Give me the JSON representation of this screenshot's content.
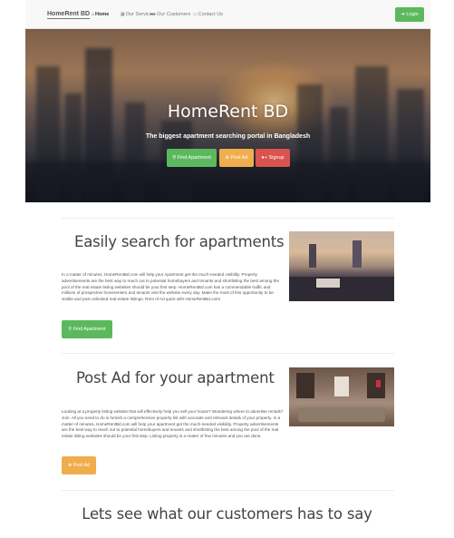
{
  "navbar": {
    "brand": "HomeRent BD",
    "links": [
      {
        "label": "Home",
        "icon": "home-icon",
        "glyph": "⌂",
        "active": true
      },
      {
        "label": "Our Services",
        "icon": "services-icon",
        "glyph": "▦",
        "active": false
      },
      {
        "label": "Our Customers",
        "icon": "users-icon",
        "glyph": "👥",
        "active": false
      },
      {
        "label": "Contact Us",
        "icon": "card-icon",
        "glyph": "▭",
        "active": false
      }
    ],
    "login": {
      "label": "Login",
      "icon": "login-icon",
      "glyph": "➜"
    }
  },
  "hero": {
    "title": "HomeRent BD",
    "subtitle": "The biggest apartment searching portal in Bangladesh",
    "buttons": [
      {
        "label": "Find Apartment",
        "icon": "search-icon",
        "glyph": "⚲",
        "color": "#5cb85c"
      },
      {
        "label": "Post Ad",
        "icon": "plus-circle-icon",
        "glyph": "⊕",
        "color": "#f0ad4e"
      },
      {
        "label": "Signup",
        "icon": "user-plus-icon",
        "glyph": "👤",
        "color": "#d9534f"
      }
    ]
  },
  "search_section": {
    "title": "Easily search for apartments",
    "text": "In a matter of minutes, HomeRentBd.com will help your Apartment get the much-needed visibility. Property advertisements are the best way to reach out to potential homebuyers and tenants and shortlisting the best among the pool of the real estate listing websites should be your first step. HomeRentBd.com has a commendable traffic and millions of prospective homerenters and tenants visit the website every day. Make the most of this opportunity to be visible and post unlimited real-estate listings. Rent of Ad quick with HomeRentBd.com!",
    "button": {
      "label": "Find Apartment",
      "glyph": "⚲",
      "color": "#5cb85c"
    }
  },
  "post_section": {
    "title": "Post Ad for your apartment",
    "text": "Looking at a property listing website that will effectively help you sell your house? Wondering where to advertise rentals? Join. All you need to do is furnish a comprehensive property list with accurate and relevant details of your property. In a matter of minutes, HomeRentBd.com will help your apartment get the much-needed visibility. Property advertisements are the best way to reach out to potential homebuyers and tenants and shortlisting the best among the pool of the real estate listing websites should be your first step. Listing property is a matter of few minutes and you are done.",
    "button": {
      "label": "Post Ad",
      "glyph": "⊕",
      "color": "#f0ad4e"
    }
  },
  "customers": {
    "title": "Lets see what our customers has to say"
  }
}
